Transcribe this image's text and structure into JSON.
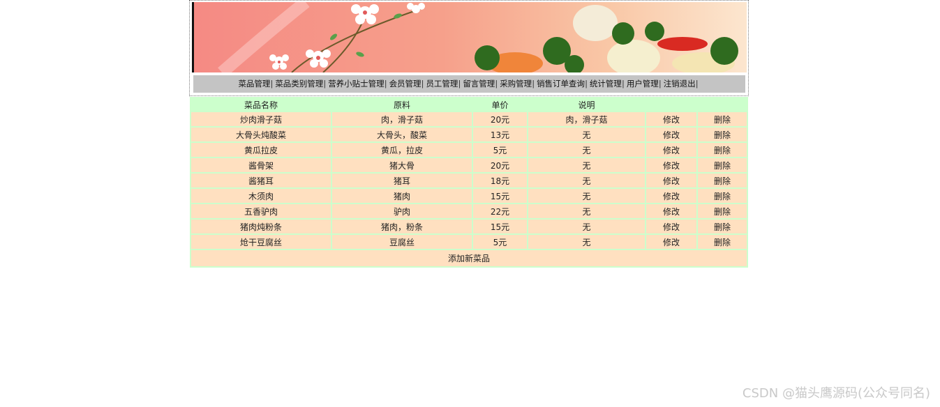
{
  "menu": [
    "菜品管理",
    "菜品类别管理",
    "营养小贴士管理",
    "会员管理",
    "员工管理",
    "留言管理",
    "采购管理",
    "销售订单查询",
    "统计管理",
    "用户管理",
    "注销退出"
  ],
  "table": {
    "headers": [
      "菜品名称",
      "原料",
      "单价",
      "说明"
    ],
    "edit_label": "修改",
    "delete_label": "删除",
    "rows": [
      {
        "name": "炒肉滑子菇",
        "ingredients": "肉，滑子菇",
        "price": "20元",
        "note": "肉，滑子菇"
      },
      {
        "name": "大骨头炖酸菜",
        "ingredients": "大骨头，酸菜",
        "price": "13元",
        "note": "无"
      },
      {
        "name": "黄瓜拉皮",
        "ingredients": "黄瓜，拉皮",
        "price": "5元",
        "note": "无"
      },
      {
        "name": "酱骨架",
        "ingredients": "猪大骨",
        "price": "20元",
        "note": "无"
      },
      {
        "name": "酱猪耳",
        "ingredients": "猪耳",
        "price": "18元",
        "note": "无"
      },
      {
        "name": "木须肉",
        "ingredients": "猪肉",
        "price": "15元",
        "note": "无"
      },
      {
        "name": "五香驴肉",
        "ingredients": "驴肉",
        "price": "22元",
        "note": "无"
      },
      {
        "name": "猪肉炖粉条",
        "ingredients": "猪肉，粉条",
        "price": "15元",
        "note": "无"
      },
      {
        "name": "炝干豆腐丝",
        "ingredients": "豆腐丝",
        "price": "5元",
        "note": "无"
      }
    ],
    "add_label": "添加新菜品"
  },
  "watermark": "CSDN @猫头鹰源码(公众号同名)"
}
